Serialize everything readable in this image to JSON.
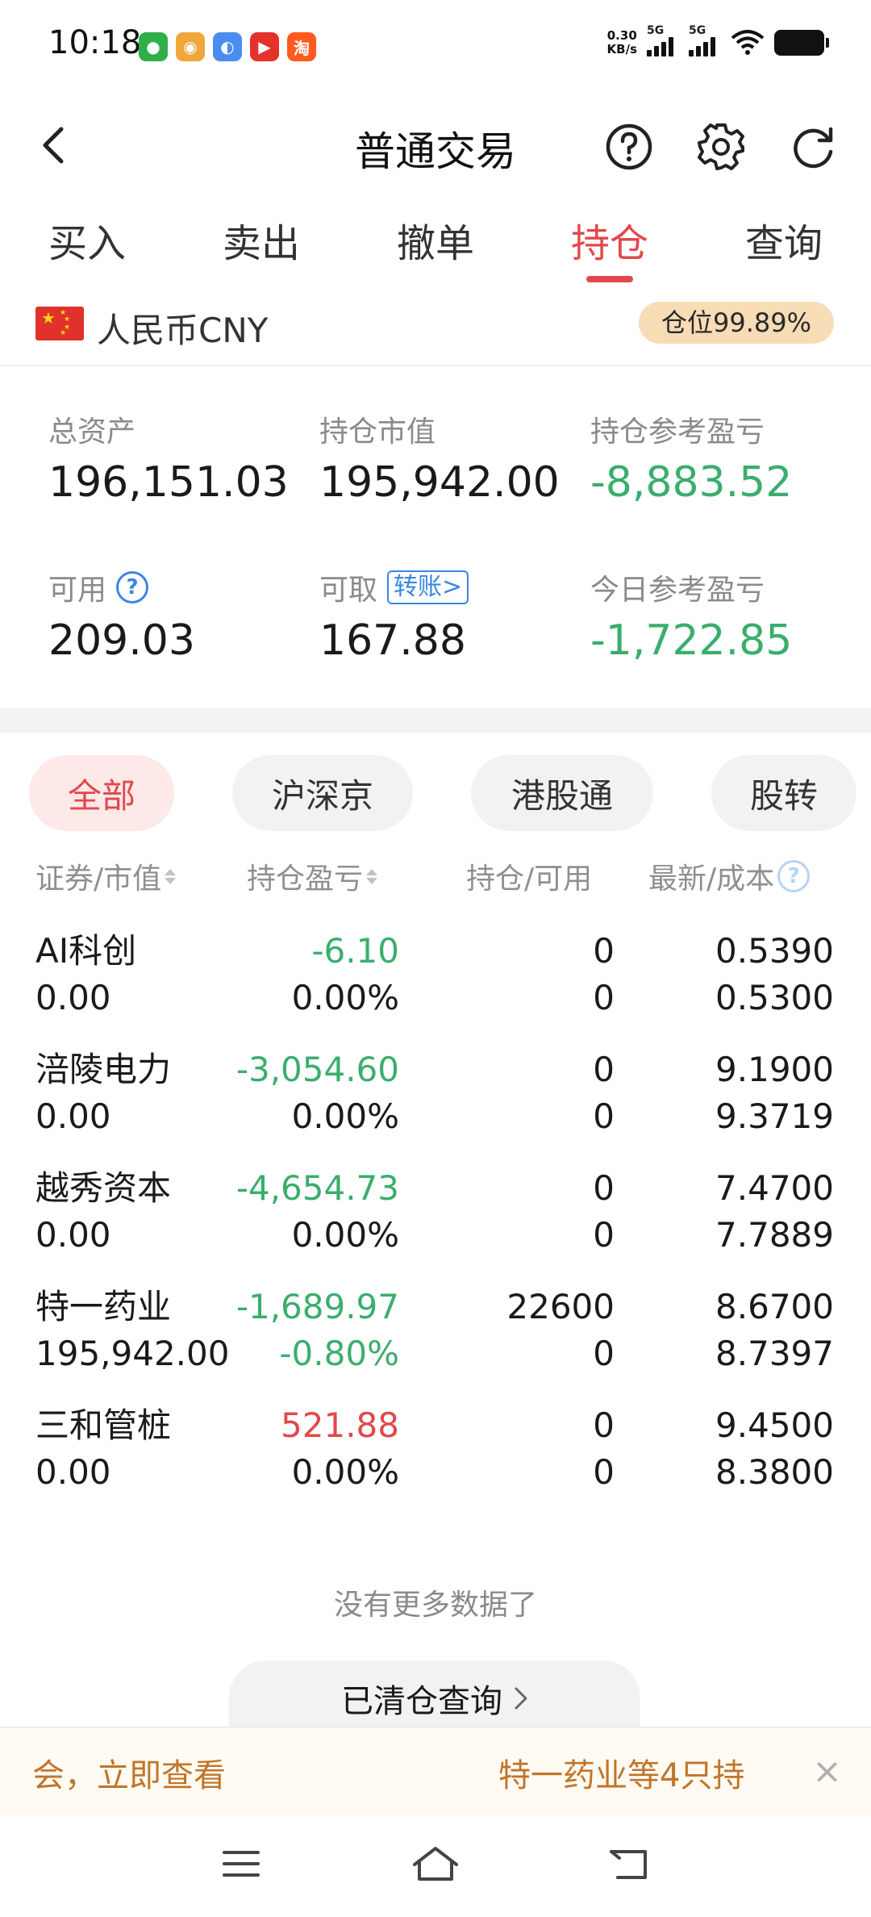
{
  "status_bar": {
    "time": "10:18",
    "net_speed_value": "0.30",
    "net_speed_unit": "KB/s",
    "signal_1": "5G",
    "signal_2": "5G",
    "app_icons": [
      "green-leaf-app-icon",
      "orange-app-icon",
      "blue-app-icon",
      "red-video-app-icon",
      "taobao-icon"
    ]
  },
  "header": {
    "title": "普通交易",
    "icons": [
      "back-arrow-icon",
      "help-icon",
      "gear-icon",
      "refresh-icon"
    ]
  },
  "tabs": {
    "buy": "买入",
    "sell": "卖出",
    "cancel": "撤单",
    "positions": "持仓",
    "query": "查询",
    "active": "持仓"
  },
  "currency": {
    "label": "人民币CNY",
    "position_ratio": "仓位99.89%"
  },
  "summary": {
    "total_assets_label": "总资产",
    "total_assets": "196,151.03",
    "market_value_label": "持仓市值",
    "market_value": "195,942.00",
    "position_pl_label": "持仓参考盈亏",
    "position_pl": "-8,883.52",
    "available_label": "可用",
    "available": "209.03",
    "withdrawable_label": "可取",
    "transfer_label": "转账>",
    "withdrawable": "167.88",
    "today_pl_label": "今日参考盈亏",
    "today_pl": "-1,722.85"
  },
  "filters": {
    "all": "全部",
    "sh_sz_bj": "沪深京",
    "hk_connect": "港股通",
    "share_transfer": "股转",
    "active": "全部"
  },
  "table": {
    "col_security": "证券/市值",
    "col_pl": "持仓盈亏",
    "col_holding": "持仓/可用",
    "col_price": "最新/成本",
    "rows": [
      {
        "name": "AI科创",
        "market_value": "0.00",
        "pl": "-6.10",
        "pl_pct": "0.00%",
        "holding": "0",
        "available": "0",
        "last": "0.5390",
        "cost": "0.5300"
      },
      {
        "name": "涪陵电力",
        "market_value": "0.00",
        "pl": "-3,054.60",
        "pl_pct": "0.00%",
        "holding": "0",
        "available": "0",
        "last": "9.1900",
        "cost": "9.3719"
      },
      {
        "name": "越秀资本",
        "market_value": "0.00",
        "pl": "-4,654.73",
        "pl_pct": "0.00%",
        "holding": "0",
        "available": "0",
        "last": "7.4700",
        "cost": "7.7889"
      },
      {
        "name": "特一药业",
        "market_value": "195,942.00",
        "pl": "-1,689.97",
        "pl_pct": "-0.80%",
        "holding": "22600",
        "available": "0",
        "last": "8.6700",
        "cost": "8.7397"
      },
      {
        "name": "三和管桩",
        "market_value": "0.00",
        "pl": "521.88",
        "pl_pct": "0.00%",
        "holding": "0",
        "available": "0",
        "last": "9.4500",
        "cost": "8.3800"
      }
    ]
  },
  "footer": {
    "no_more": "没有更多数据了",
    "cleared_query": "已清仓查询",
    "ticker_left": "会，立即查看",
    "ticker_right": "特一药业等4只持",
    "close": "×"
  },
  "colors": {
    "accent_red": "#e2484b",
    "loss_green": "#3aae6d",
    "link_blue": "#3b86e4",
    "badge_bg": "#f8dcb6",
    "ticker_text": "#c0752a"
  }
}
